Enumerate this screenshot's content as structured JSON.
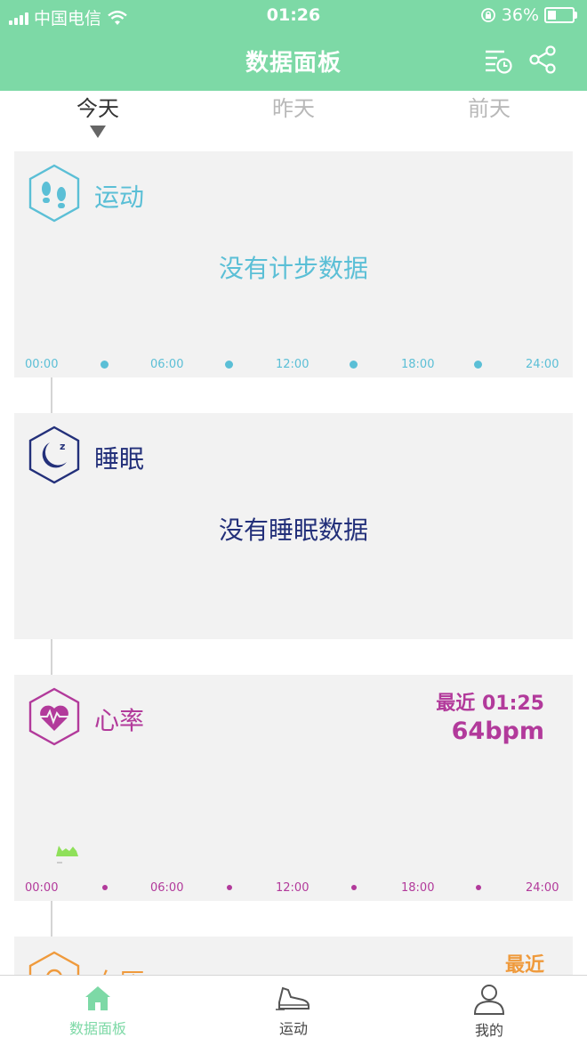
{
  "status_bar": {
    "carrier": "中国电信",
    "time": "01:26",
    "battery": "36%",
    "battery_level": 0.36
  },
  "header": {
    "title": "数据面板"
  },
  "day_tabs": [
    {
      "label": "今天",
      "active": true
    },
    {
      "label": "昨天",
      "active": false
    },
    {
      "label": "前天",
      "active": false
    }
  ],
  "cards": {
    "activity": {
      "label": "运动",
      "empty": "没有计步数据",
      "color": "#5bbfd6"
    },
    "sleep": {
      "label": "睡眠",
      "empty": "没有睡眠数据",
      "color": "#23307a"
    },
    "heart": {
      "label": "心率",
      "recent_label": "最近 01:25",
      "recent_value": "64bpm",
      "color": "#b23a9b"
    },
    "blood_pressure": {
      "label": "血压",
      "recent_label": "最近",
      "color": "#ef9a3c"
    }
  },
  "time_axis": [
    "00:00",
    "06:00",
    "12:00",
    "18:00",
    "24:00"
  ],
  "bottom_nav": [
    {
      "label": "数据面板",
      "active": true
    },
    {
      "label": "运动",
      "active": false
    },
    {
      "label": "我的",
      "active": false
    }
  ],
  "colors": {
    "header_bg": "#7dd9a6",
    "nav_active": "#7dd9a6",
    "nav_inactive": "#444444",
    "heart_graph": "#8fe05a"
  }
}
